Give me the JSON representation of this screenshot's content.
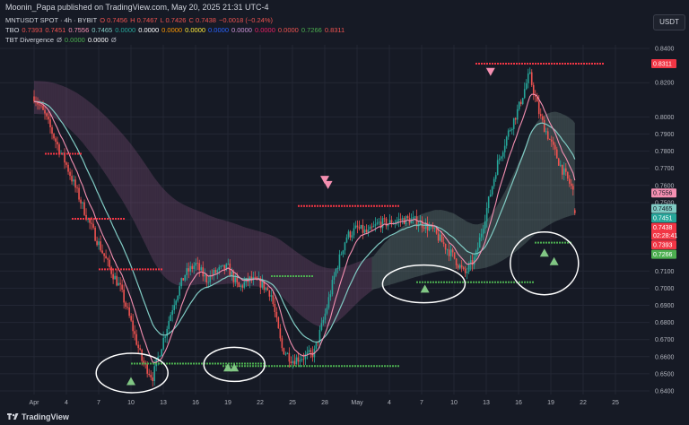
{
  "header": {
    "publisher": "Moonin_Papa published on TradingView.com, May 20, 2025 21:31 UTC-4"
  },
  "legend": {
    "line1": [
      {
        "text": "MNTUSDT SPOT · 4h · BYBIT",
        "color": "#d1d4dc"
      },
      {
        "text": "O 0.7456",
        "color": "#ef5350"
      },
      {
        "text": "H 0.7467",
        "color": "#ef5350"
      },
      {
        "text": "L 0.7426",
        "color": "#ef5350"
      },
      {
        "text": "C 0.7438",
        "color": "#ef5350"
      },
      {
        "text": "−0.0018 (−0.24%)",
        "color": "#ef5350"
      }
    ],
    "line2": [
      {
        "text": "TBO",
        "color": "#d1d4dc"
      },
      {
        "text": "0.7393",
        "color": "#ef5350"
      },
      {
        "text": "0.7451",
        "color": "#ef5350"
      },
      {
        "text": "0.7556",
        "color": "#f48fb1"
      },
      {
        "text": "0.7465",
        "color": "#80cbc4"
      },
      {
        "text": "0.0000",
        "color": "#26a69a"
      },
      {
        "text": "0.0000",
        "color": "#ffffff"
      },
      {
        "text": "0.0000",
        "color": "#ff9800"
      },
      {
        "text": "0.0000",
        "color": "#ffeb3b"
      },
      {
        "text": "0.0000",
        "color": "#2962ff"
      },
      {
        "text": "0.0000",
        "color": "#ce93d8"
      },
      {
        "text": "0.0000",
        "color": "#e91e63"
      },
      {
        "text": "0.0000",
        "color": "#ef5350"
      },
      {
        "text": "0.7266",
        "color": "#4caf50"
      },
      {
        "text": "0.8311",
        "color": "#ef5350"
      }
    ],
    "line3": [
      {
        "text": "TBT Divergence",
        "color": "#d1d4dc"
      },
      {
        "text": "Ø",
        "color": "#b2b5be"
      },
      {
        "text": "0.0000",
        "color": "#4caf50"
      },
      {
        "text": "0.0000",
        "color": "#ffffff"
      },
      {
        "text": "Ø",
        "color": "#b2b5be"
      }
    ]
  },
  "currency_button": "USDT",
  "footer": {
    "brand": "TradingView"
  },
  "colors": {
    "background": "#161a25",
    "up": "#26a69a",
    "down": "#ef5350",
    "resistance": "#f23645",
    "support": "#4caf50",
    "fast_line": "#f48fb1",
    "slow_line": "#80cbc4"
  },
  "chart_data": {
    "type": "candlestick",
    "symbol": "MNTUSDT SPOT",
    "interval": "4h",
    "exchange": "BYBIT",
    "y_axis": {
      "ylim": [
        0.6325,
        0.8455
      ],
      "ticks": [
        "0.8400",
        "0.8200",
        "0.8000",
        "0.7900",
        "0.7800",
        "0.7700",
        "0.7600",
        "0.7500",
        "0.7400",
        "0.7300",
        "0.7200",
        "0.7100",
        "0.7000",
        "0.6900",
        "0.6800",
        "0.6700",
        "0.6600",
        "0.6500",
        "0.6400"
      ]
    },
    "x_axis": {
      "ticks": [
        "Apr",
        "4",
        "7",
        "10",
        "13",
        "16",
        "19",
        "22",
        "25",
        "28",
        "May",
        "4",
        "7",
        "10",
        "13",
        "16",
        "19",
        "22",
        "25"
      ],
      "tick_day_index": [
        0,
        3,
        6,
        9,
        12,
        15,
        18,
        21,
        24,
        27,
        30,
        33,
        36,
        39,
        42,
        45,
        48,
        51,
        54
      ]
    },
    "candles_per_day": 6,
    "last_candle_day_index": 50.4,
    "close_series": [
      0.812,
      0.801,
      0.786,
      0.772,
      0.756,
      0.74,
      0.726,
      0.712,
      0.7,
      0.68,
      0.658,
      0.648,
      0.67,
      0.692,
      0.708,
      0.714,
      0.705,
      0.71,
      0.712,
      0.7,
      0.705,
      0.703,
      0.697,
      0.665,
      0.658,
      0.66,
      0.662,
      0.684,
      0.71,
      0.73,
      0.735,
      0.732,
      0.738,
      0.738,
      0.74,
      0.74,
      0.738,
      0.734,
      0.726,
      0.718,
      0.708,
      0.718,
      0.745,
      0.772,
      0.79,
      0.805,
      0.825,
      0.8,
      0.785,
      0.77,
      0.758,
      0.73,
      0.74,
      0.725,
      0.732,
      0.738
    ],
    "price_labels": [
      {
        "value": "0.8311",
        "y": 0.8311,
        "bg": "#f23645",
        "fg": "#ffffff"
      },
      {
        "value": "0.7556",
        "y": 0.7556,
        "bg": "#f48fb1",
        "fg": "#131722"
      },
      {
        "value": "0.7465",
        "y": 0.7465,
        "bg": "#80cbc4",
        "fg": "#131722"
      },
      {
        "value": "0.7451",
        "y": 0.7451,
        "bg": "#26a69a",
        "fg": "#ffffff"
      },
      {
        "value": "0.7438",
        "y": 0.7438,
        "bg": "#f23645",
        "fg": "#ffffff",
        "sub": "02:28:41"
      },
      {
        "value": "0.7393",
        "y": 0.7393,
        "bg": "#f23645",
        "fg": "#ffffff"
      },
      {
        "value": "0.7266",
        "y": 0.7266,
        "bg": "#4caf50",
        "fg": "#ffffff"
      }
    ],
    "levels": [
      {
        "kind": "resistance",
        "price": 0.7785,
        "from_day": 1.0,
        "to_day": 4.5
      },
      {
        "kind": "resistance",
        "price": 0.7405,
        "from_day": 3.5,
        "to_day": 8.5
      },
      {
        "kind": "resistance",
        "price": 0.711,
        "from_day": 6.0,
        "to_day": 12.0
      },
      {
        "kind": "resistance",
        "price": 0.748,
        "from_day": 24.5,
        "to_day": 34.0
      },
      {
        "kind": "resistance",
        "price": 0.8311,
        "from_day": 41.0,
        "to_day": 53.0
      },
      {
        "kind": "support",
        "price": 0.656,
        "from_day": 9.0,
        "to_day": 21.5
      },
      {
        "kind": "support",
        "price": 0.6545,
        "from_day": 17.5,
        "to_day": 34.0
      },
      {
        "kind": "support",
        "price": 0.707,
        "from_day": 22.0,
        "to_day": 26.0
      },
      {
        "kind": "support",
        "price": 0.7035,
        "from_day": 35.5,
        "to_day": 46.5
      },
      {
        "kind": "support",
        "price": 0.7266,
        "from_day": 46.5,
        "to_day": 50.0
      }
    ],
    "signals": [
      {
        "type": "buy",
        "day": 9.0,
        "price": 0.6455
      },
      {
        "type": "buy",
        "day": 18.0,
        "price": 0.6535
      },
      {
        "type": "buy",
        "day": 18.6,
        "price": 0.6535
      },
      {
        "type": "buy",
        "day": 36.3,
        "price": 0.6995
      },
      {
        "type": "buy",
        "day": 47.4,
        "price": 0.7205
      },
      {
        "type": "buy",
        "day": 48.3,
        "price": 0.7155
      },
      {
        "type": "sell",
        "day": 27.0,
        "price": 0.7635
      },
      {
        "type": "sell",
        "day": 27.3,
        "price": 0.7605
      },
      {
        "type": "sell",
        "day": 42.4,
        "price": 0.8265
      }
    ]
  }
}
